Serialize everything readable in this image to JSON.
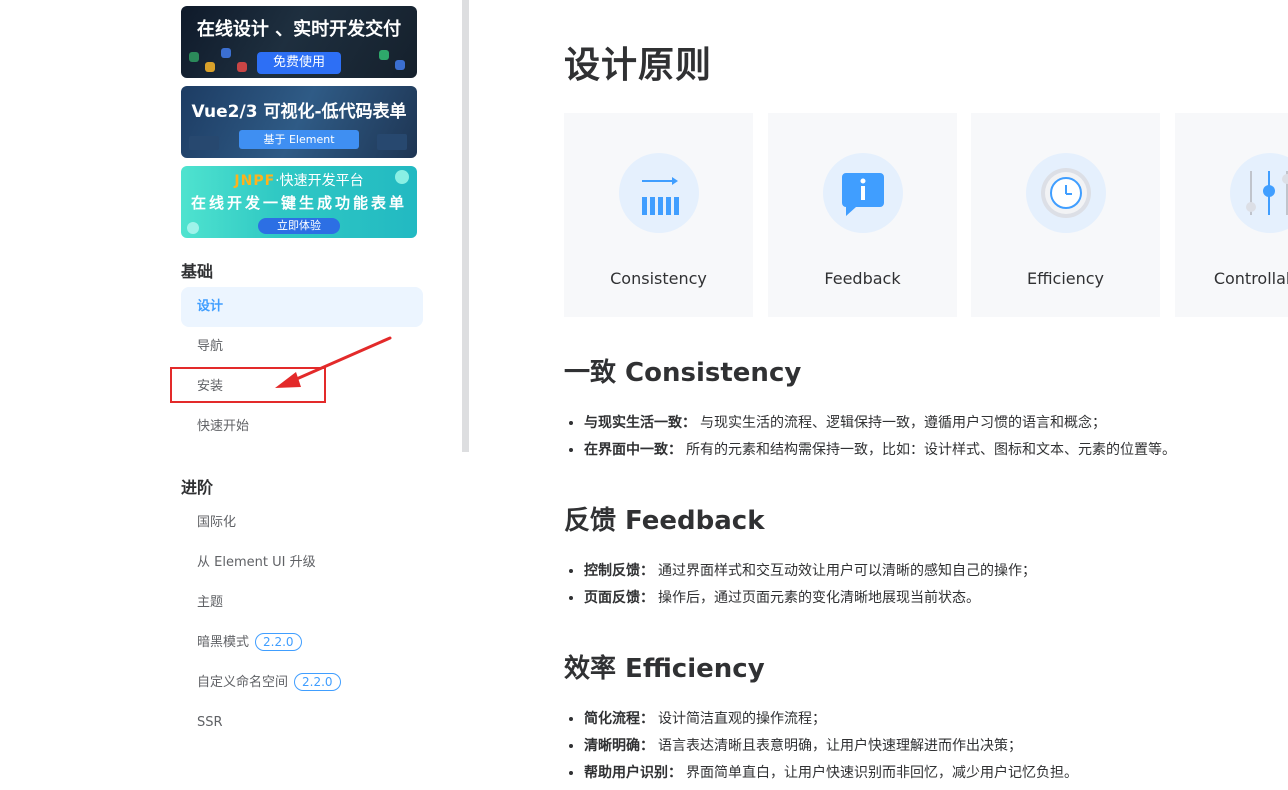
{
  "ads": [
    {
      "title": "在线设计 、实时开发交付",
      "button": "免费使用"
    },
    {
      "title": "Vue2/3 可视化-低代码表单",
      "button": "基于 Element"
    },
    {
      "brand": "JNPF",
      "title_rest": "·快速开发平台",
      "subtitle": "在线开发一键生成功能表单",
      "button": "立即体验"
    }
  ],
  "sidebar": {
    "group_basic": "基础",
    "basic_items": [
      {
        "label": "设计"
      },
      {
        "label": "导航"
      },
      {
        "label": "安装"
      },
      {
        "label": "快速开始"
      }
    ],
    "group_advanced": "进阶",
    "advanced_items": [
      {
        "label": "国际化"
      },
      {
        "label": "从 Element UI 升级"
      },
      {
        "label": "主题"
      },
      {
        "label": "暗黑模式",
        "badge": "2.2.0"
      },
      {
        "label": "自定义命名空间",
        "badge": "2.2.0"
      },
      {
        "label": "SSR"
      }
    ]
  },
  "main": {
    "title": "设计原则",
    "cards": [
      {
        "label": "Consistency",
        "icon": "consistency-icon"
      },
      {
        "label": "Feedback",
        "icon": "feedback-icon"
      },
      {
        "label": "Efficiency",
        "icon": "efficiency-icon"
      },
      {
        "label": "Controllability",
        "icon": "controllability-icon"
      }
    ],
    "sections": [
      {
        "title": "一致 Consistency",
        "items": [
          {
            "term": "与现实生活一致：",
            "text": "与现实生活的流程、逻辑保持一致，遵循用户习惯的语言和概念；"
          },
          {
            "term": "在界面中一致：",
            "text": "所有的元素和结构需保持一致，比如：设计样式、图标和文本、元素的位置等。"
          }
        ]
      },
      {
        "title": "反馈 Feedback",
        "items": [
          {
            "term": "控制反馈：",
            "text": "通过界面样式和交互动效让用户可以清晰的感知自己的操作；"
          },
          {
            "term": "页面反馈：",
            "text": "操作后，通过页面元素的变化清晰地展现当前状态。"
          }
        ]
      },
      {
        "title": "效率 Efficiency",
        "items": [
          {
            "term": "简化流程：",
            "text": "设计简洁直观的操作流程；"
          },
          {
            "term": "清晰明确：",
            "text": "语言表达清晰且表意明确，让用户快速理解进而作出决策；"
          },
          {
            "term": "帮助用户识别：",
            "text": "界面简单直白，让用户快速识别而非回忆，减少用户记忆负担。"
          }
        ]
      }
    ]
  },
  "colors": {
    "accent": "#409eff",
    "active_bg": "#ecf5ff",
    "annotation": "#e32a2a",
    "card_bg": "#f7f8fa",
    "icon_bg": "#e5f0fd"
  }
}
